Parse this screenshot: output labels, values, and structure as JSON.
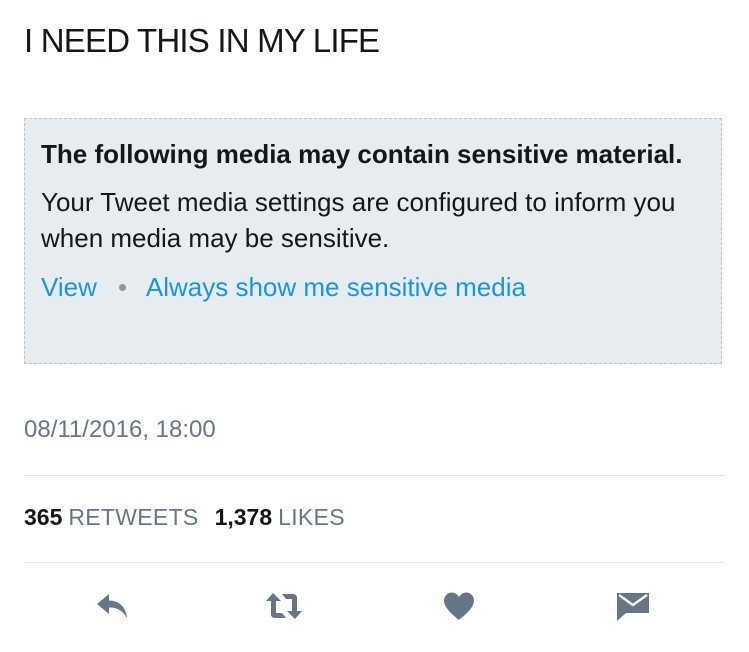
{
  "tweet": {
    "text": "I NEED THIS IN MY LIFE"
  },
  "sensitive_notice": {
    "title": "The following media may contain sensitive material.",
    "description": "Your Tweet media settings are configured to inform you when media may be sensitive.",
    "view_label": "View",
    "always_show_label": "Always show me sensitive media"
  },
  "meta": {
    "timestamp": "08/11/2016, 18:00"
  },
  "stats": {
    "retweets_count": "365",
    "retweets_label": "RETWEETS",
    "likes_count": "1,378",
    "likes_label": "LIKES"
  },
  "actions": {
    "icons": [
      "reply-icon",
      "retweet-icon",
      "like-icon",
      "direct-message-icon"
    ],
    "icon_color": "#657786"
  },
  "colors": {
    "link": "#1b95e0",
    "notice_background": "#e6ecf0",
    "secondary_text": "#657786"
  }
}
